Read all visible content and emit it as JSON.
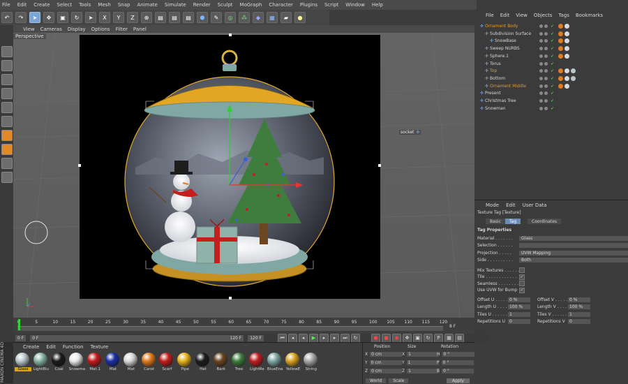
{
  "main_menu": [
    "File",
    "Edit",
    "Create",
    "Select",
    "Tools",
    "Mesh",
    "Snap",
    "Animate",
    "Simulate",
    "Render",
    "Sculpt",
    "MoGraph",
    "Character",
    "Plugins",
    "Script",
    "Window",
    "Help"
  ],
  "toolbar": {
    "axis_buttons": [
      "X",
      "Y",
      "Z"
    ]
  },
  "viewport": {
    "menu": [
      "View",
      "Cameras",
      "Display",
      "Options",
      "Filter",
      "Panel"
    ],
    "label": "Perspective",
    "socket_label": "socket"
  },
  "object_manager": {
    "menu": [
      "File",
      "Edit",
      "View",
      "Objects",
      "Tags",
      "Bookmarks"
    ],
    "items": [
      {
        "name": "Ornament Body",
        "indent": 0,
        "color": "#e59b22"
      },
      {
        "name": "Subdivision Surface",
        "indent": 1,
        "color": "#d8d8d8"
      },
      {
        "name": "SnowBase",
        "indent": 2,
        "color": "#d8d8d8"
      },
      {
        "name": "Sweep NURBS",
        "indent": 1,
        "color": "#d8d8d8"
      },
      {
        "name": "Sphere.1",
        "indent": 1,
        "color": "#d8d8d8"
      },
      {
        "name": "Torus",
        "indent": 1,
        "color": "#d8d8d8"
      },
      {
        "name": "Top",
        "indent": 1,
        "color": "#e59b22"
      },
      {
        "name": "Bottom",
        "indent": 1,
        "color": "#d8d8d8"
      },
      {
        "name": "Ornament Middle",
        "indent": 1,
        "color": "#e59b22"
      },
      {
        "name": "Present",
        "indent": 0,
        "color": "#d8d8d8"
      },
      {
        "name": "Christmas Tree",
        "indent": 0,
        "color": "#d8d8d8"
      },
      {
        "name": "Snowman",
        "indent": 0,
        "color": "#d8d8d8"
      }
    ]
  },
  "attribute_manager": {
    "menu": [
      "Mode",
      "Edit",
      "User Data"
    ],
    "title": "Texture Tag [Texture]",
    "tabs": [
      "Basic",
      "Tag",
      "Coordinates"
    ],
    "section": "Tag Properties",
    "props": [
      {
        "label": "Material . . . . . . .",
        "value": "Glass"
      },
      {
        "label": "Selection . . . . . .",
        "value": ""
      },
      {
        "label": "Projection . . . . .",
        "value": "UVW Mapping"
      },
      {
        "label": "Side . . . . . . . . . .",
        "value": "Both"
      }
    ],
    "checks": [
      {
        "label": "Mix Textures . . . . . .",
        "checked": ""
      },
      {
        "label": "Tile . . . . . . . . . . . .",
        "checked": "✓"
      },
      {
        "label": "Seamless . . . . . . . .",
        "checked": ""
      },
      {
        "label": "Use UVW for Bump",
        "checked": "✓"
      }
    ],
    "numbers_left": [
      {
        "label": "Offset U . . . . .",
        "value": "0 %"
      },
      {
        "label": "Length U . . . .",
        "value": "100 %"
      },
      {
        "label": "Tiles U . . . . . .",
        "value": "1"
      },
      {
        "label": "Repetitions U",
        "value": "0"
      }
    ],
    "numbers_right": [
      {
        "label": "Offset V . . . . .",
        "value": "0 %"
      },
      {
        "label": "Length V . . . .",
        "value": "100 %"
      },
      {
        "label": "Tiles V . . . . . .",
        "value": "1"
      },
      {
        "label": "Repetitions V",
        "value": "0"
      }
    ]
  },
  "timeline": {
    "ticks": [
      "0",
      "5",
      "10",
      "15",
      "20",
      "25",
      "30",
      "35",
      "40",
      "45",
      "50",
      "55",
      "60",
      "65",
      "70",
      "75",
      "80",
      "85",
      "90",
      "95",
      "100",
      "105",
      "110",
      "115",
      "120"
    ],
    "current_frame": "8 F",
    "start": "0 F",
    "field2": "0 F",
    "end1": "120 F",
    "end2": "120 F"
  },
  "material_manager": {
    "menu": [
      "Create",
      "Edit",
      "Function",
      "Texture"
    ],
    "materials": [
      {
        "name": "Glass",
        "color": "#b9c7cc"
      },
      {
        "name": "LightBlu",
        "color": "#86b3a6"
      },
      {
        "name": "Coal",
        "color": "#1a1a1a"
      },
      {
        "name": "Snowma",
        "color": "#e8e8e8"
      },
      {
        "name": "Mat.1",
        "color": "#c51c1c"
      },
      {
        "name": "Mat",
        "color": "#1b2fa6"
      },
      {
        "name": "Mat",
        "color": "#d8d8d8"
      },
      {
        "name": "Carot",
        "color": "#e07b1f"
      },
      {
        "name": "Scarf",
        "color": "#c41e1e"
      },
      {
        "name": "Pipe",
        "color": "#e6b41c"
      },
      {
        "name": "Hat",
        "color": "#1d1d1d"
      },
      {
        "name": "Bark",
        "color": "#6b4620"
      },
      {
        "name": "Tree",
        "color": "#3f7d3f"
      },
      {
        "name": "LightRe",
        "color": "#c01f1f"
      },
      {
        "name": "BlueEna",
        "color": "#7fa7a4"
      },
      {
        "name": "YellowE",
        "color": "#d9a321"
      },
      {
        "name": "String",
        "color": "#a8a8a8"
      }
    ]
  },
  "coord_manager": {
    "headers": [
      "Position",
      "Size",
      "Rotation"
    ],
    "rows": [
      {
        "axis": "X",
        "pos": "0 cm",
        "size_axis": "X",
        "size": "1",
        "rot_axis": "H",
        "rot": "0 °"
      },
      {
        "axis": "Y",
        "pos": "0 cm",
        "size_axis": "Y",
        "size": "1",
        "rot_axis": "P",
        "rot": "0 °"
      },
      {
        "axis": "Z",
        "pos": "0 cm",
        "size_axis": "Z",
        "size": "1",
        "rot_axis": "B",
        "rot": "0 °"
      }
    ],
    "mode1": "World",
    "mode2": "Scale",
    "apply": "Apply"
  },
  "brand": "MAXON CINEMA 4D"
}
